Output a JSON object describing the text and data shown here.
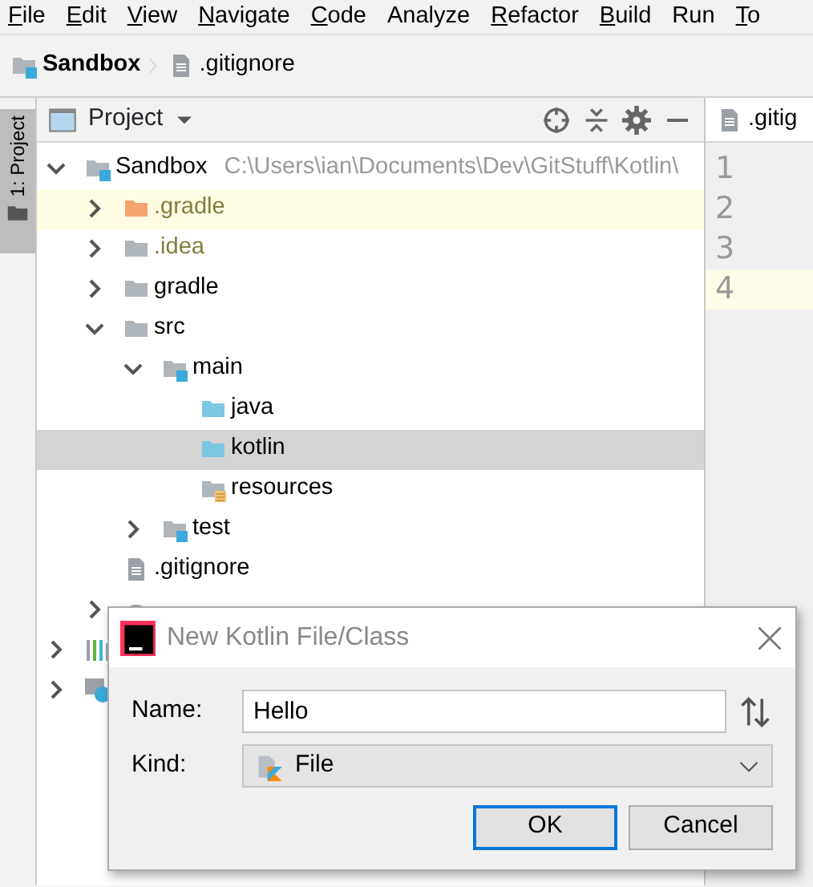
{
  "menu": [
    {
      "key": "F",
      "after": "ile"
    },
    {
      "key": "E",
      "after": "dit"
    },
    {
      "key": "V",
      "after": "iew"
    },
    {
      "key": "N",
      "after": "avigate"
    },
    {
      "key": "C",
      "after": "ode"
    },
    {
      "label": "Analyze"
    },
    {
      "key": "R",
      "after": "efactor"
    },
    {
      "key": "B",
      "after": "uild"
    },
    {
      "label": "Run"
    },
    {
      "key": "T",
      "after": "o"
    }
  ],
  "breadcrumb": [
    {
      "label": "Sandbox",
      "kind": "module"
    },
    {
      "label": ".gitignore",
      "kind": "file-text"
    }
  ],
  "side_tab": {
    "label": "1: Project",
    "selected": true
  },
  "project_panel": {
    "title": "Project",
    "tree": [
      {
        "label": "Sandbox",
        "path": "C:\\Users\\ian\\Documents\\Dev\\GitStuff\\Kotlin\\",
        "kind": "module",
        "expanded": true,
        "children": [
          {
            "label": ".gradle",
            "kind": "folder-excluded",
            "expanded": false,
            "ignored": true,
            "highlighted": true,
            "selected": false
          },
          {
            "label": ".idea",
            "kind": "folder",
            "expanded": false,
            "ignored": true,
            "highlighted": false,
            "selected": false
          },
          {
            "label": "gradle",
            "kind": "folder",
            "expanded": false,
            "ignored": false,
            "highlighted": false,
            "selected": false
          },
          {
            "label": "src",
            "kind": "folder",
            "expanded": true,
            "ignored": false,
            "highlighted": false,
            "selected": false,
            "children": [
              {
                "label": "main",
                "kind": "module",
                "expanded": true,
                "ignored": false,
                "highlighted": false,
                "selected": false,
                "children": [
                  {
                    "label": "java",
                    "kind": "source",
                    "ignored": false,
                    "highlighted": false,
                    "selected": false
                  },
                  {
                    "label": "kotlin",
                    "kind": "source",
                    "ignored": false,
                    "highlighted": false,
                    "selected": true
                  },
                  {
                    "label": "resources",
                    "kind": "resources",
                    "ignored": false,
                    "highlighted": false,
                    "selected": false
                  }
                ]
              },
              {
                "label": "test",
                "kind": "module",
                "expanded": false,
                "ignored": false,
                "highlighted": false,
                "selected": false
              }
            ]
          },
          {
            "label": ".gitignore",
            "kind": "file-text",
            "ignored": false,
            "highlighted": false,
            "selected": false
          },
          {
            "kind": "gradle-file",
            "expanded": false,
            "highlighted": false,
            "selected": false
          }
        ]
      },
      {
        "kind": "libraries",
        "expanded": false
      },
      {
        "kind": "scratches",
        "expanded": false
      }
    ]
  },
  "editor": {
    "tab": ".gitig",
    "lines": [
      {
        "number": "1",
        "current": false
      },
      {
        "number": "2",
        "current": false
      },
      {
        "number": "3",
        "current": false
      },
      {
        "number": "4",
        "current": true
      }
    ]
  },
  "dialog": {
    "title": "New Kotlin File/Class",
    "name_label": "Name:",
    "name_value": "Hello",
    "kind_label": "Kind:",
    "kind_value": "File",
    "buttons": [
      {
        "label": "OK",
        "default": true
      },
      {
        "label": "Cancel",
        "default": false
      }
    ]
  }
}
